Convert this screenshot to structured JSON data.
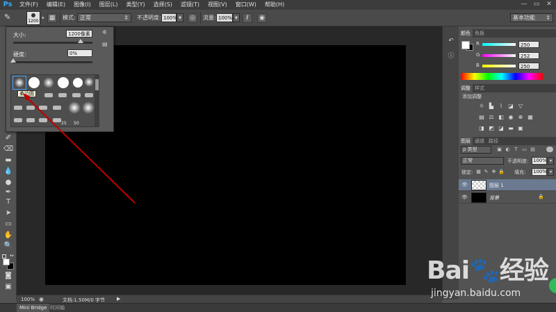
{
  "app": {
    "logo": "Ps"
  },
  "menu": [
    "文件(F)",
    "编辑(E)",
    "图像(I)",
    "图层(L)",
    "类型(Y)",
    "选择(S)",
    "滤镜(T)",
    "视图(V)",
    "窗口(W)",
    "帮助(H)"
  ],
  "window_controls": [
    "—",
    "▭",
    "✕"
  ],
  "options": {
    "brush_size": "1200",
    "mode_label": "模式:",
    "mode_value": "正常",
    "opacity_label": "不透明度:",
    "opacity_value": "100%",
    "flow_label": "流量:",
    "flow_value": "100%",
    "workspace": "基本功能"
  },
  "brush_popup": {
    "size_label": "大小:",
    "size_value": "1200像素",
    "hardness_label": "硬度:",
    "hardness_value": "0%",
    "size_slider_fraction": 0.85,
    "hardness_slider_fraction": 0.0,
    "tooltip": "柔边圆",
    "numbers": [
      "25",
      "50"
    ]
  },
  "color_panel": {
    "tabs": [
      "颜色",
      "色板"
    ],
    "r_label": "R",
    "r_value": "250",
    "g_label": "G",
    "g_value": "252",
    "b_label": "B",
    "b_value": "250"
  },
  "adjust_panel": {
    "tabs": [
      "调整",
      "样式"
    ],
    "title": "添加调整"
  },
  "layers_panel": {
    "tabs": [
      "图层",
      "通道",
      "路径"
    ],
    "filter_label": "ρ 类型",
    "blend_mode": "正常",
    "opacity_label": "不透明度:",
    "opacity_value": "100%",
    "lock_label": "锁定:",
    "fill_label": "填充:",
    "fill_value": "100%",
    "layers": [
      {
        "name": "图层 1",
        "selected": true
      },
      {
        "name": "背景",
        "selected": false
      }
    ]
  },
  "status": {
    "zoom": "100%",
    "doc_info": "文档:1.50M/0 字节"
  },
  "bottom_tabs": [
    "Mini Bridge",
    "时间轴"
  ],
  "watermark": {
    "logo": "Bai🐾经验",
    "url": "jingyan.baidu.com"
  }
}
